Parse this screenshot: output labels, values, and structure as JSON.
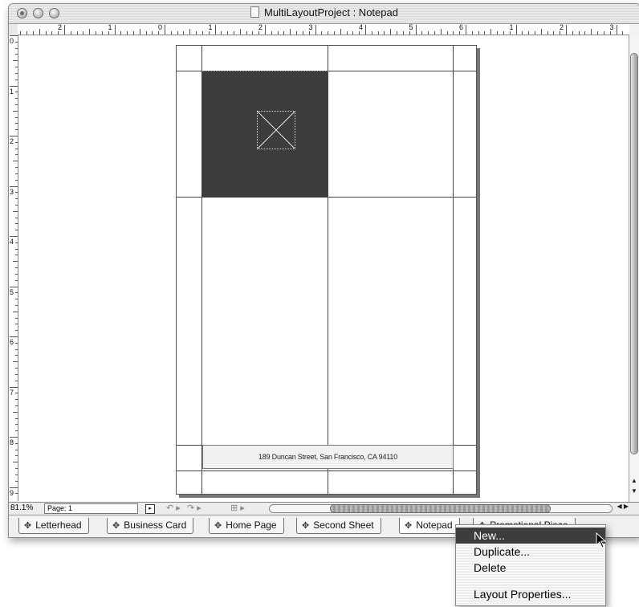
{
  "window": {
    "title": "MultiLayoutProject : Notepad"
  },
  "rulers": {
    "horizontal_labels": [
      "2",
      "1",
      "0",
      "1",
      "2",
      "3",
      "4",
      "5",
      "6",
      "1",
      "2",
      "3"
    ],
    "vertical_labels": [
      "0",
      "1",
      "2",
      "3",
      "4",
      "5",
      "6",
      "7",
      "8",
      "9"
    ]
  },
  "document": {
    "address_text": "189 Duncan Street, San Francisco, CA 94110"
  },
  "statusbar": {
    "zoom": "81.1%",
    "page_label": "Page: 1"
  },
  "tabs": [
    {
      "label": "Letterhead"
    },
    {
      "label": "Business Card"
    },
    {
      "label": "Home Page"
    },
    {
      "label": "Second Sheet"
    },
    {
      "label": "Notepad"
    },
    {
      "label": "Promotional Piece"
    }
  ],
  "context_menu": {
    "items": [
      "New...",
      "Duplicate...",
      "Delete",
      "Layout Properties..."
    ]
  },
  "icons": {
    "tab_icon": "layout-icon",
    "doc_icon": "document-icon"
  }
}
